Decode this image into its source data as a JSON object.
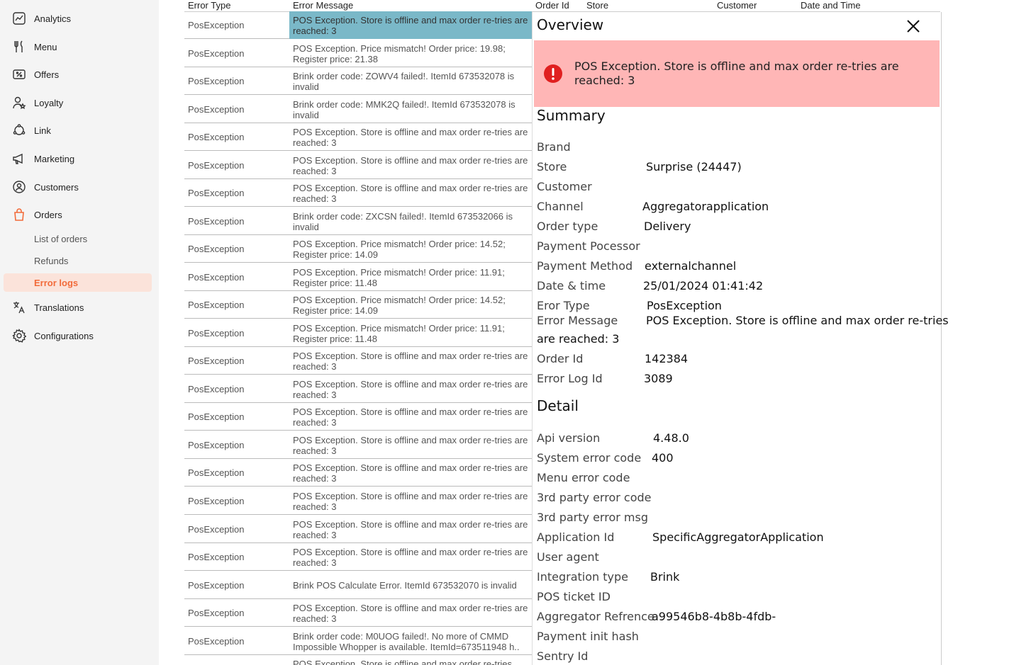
{
  "sidebar": {
    "items": [
      {
        "label": "Analytics",
        "icon": "analytics-icon"
      },
      {
        "label": "Menu",
        "icon": "fork-knife-icon"
      },
      {
        "label": "Offers",
        "icon": "offer-ticket-icon"
      },
      {
        "label": "Loyalty",
        "icon": "user-star-icon"
      },
      {
        "label": "Link",
        "icon": "link-icon"
      },
      {
        "label": "Marketing",
        "icon": "megaphone-icon"
      },
      {
        "label": "Customers",
        "icon": "customers-icon"
      },
      {
        "label": "Orders",
        "icon": "shopping-bag-icon"
      },
      {
        "label": "Translations",
        "icon": "translate-icon"
      },
      {
        "label": "Configurations",
        "icon": "gear-icon"
      }
    ],
    "orders_sub": [
      "List of orders",
      "Refunds",
      "Error logs"
    ],
    "accent": "#f26b3a"
  },
  "table": {
    "headers": {
      "error_type": "Error Type",
      "error_message": "Error Message",
      "order_id": "Order Id",
      "store": "Store",
      "customer": "Customer",
      "date_time": "Date and Time"
    },
    "rows": [
      {
        "type": "PosException",
        "msg": "POS Exception. Store is offline and max order re-tries are reached: 3"
      },
      {
        "type": "PosException",
        "msg": "POS Exception. Price mismatch! Order price: 19.98; Register price: 21.38"
      },
      {
        "type": "PosException",
        "msg": "Brink order code: ZOWV4 failed!. ItemId 673532078 is invalid"
      },
      {
        "type": "PosException",
        "msg": "Brink order code: MMK2Q failed!. ItemId 673532078 is invalid"
      },
      {
        "type": "PosException",
        "msg": "POS Exception. Store is offline and max order re-tries are reached: 3"
      },
      {
        "type": "PosException",
        "msg": "POS Exception. Store is offline and max order re-tries are reached: 3"
      },
      {
        "type": "PosException",
        "msg": "POS Exception. Store is offline and max order re-tries are reached: 3"
      },
      {
        "type": "PosException",
        "msg": "Brink order code: ZXCSN failed!. ItemId 673532066 is invalid"
      },
      {
        "type": "PosException",
        "msg": "POS Exception. Price mismatch! Order price: 14.52; Register price: 14.09"
      },
      {
        "type": "PosException",
        "msg": "POS Exception. Price mismatch! Order price: 11.91; Register price: 11.48"
      },
      {
        "type": "PosException",
        "msg": "POS Exception. Price mismatch! Order price: 14.52; Register price: 14.09"
      },
      {
        "type": "PosException",
        "msg": "POS Exception. Price mismatch! Order price: 11.91; Register price: 11.48"
      },
      {
        "type": "PosException",
        "msg": "POS Exception. Store is offline and max order re-tries are reached: 3"
      },
      {
        "type": "PosException",
        "msg": "POS Exception. Store is offline and max order re-tries are reached: 3"
      },
      {
        "type": "PosException",
        "msg": "POS Exception. Store is offline and max order re-tries are reached: 3"
      },
      {
        "type": "PosException",
        "msg": "POS Exception. Store is offline and max order re-tries are reached: 3"
      },
      {
        "type": "PosException",
        "msg": "POS Exception. Store is offline and max order re-tries are reached: 3"
      },
      {
        "type": "PosException",
        "msg": "POS Exception. Store is offline and max order re-tries are reached: 3"
      },
      {
        "type": "PosException",
        "msg": "POS Exception. Store is offline and max order re-tries are reached: 3"
      },
      {
        "type": "PosException",
        "msg": "POS Exception. Store is offline and max order re-tries are reached: 3"
      },
      {
        "type": "PosException",
        "msg": "Brink POS Calculate Error. ItemId 673532070 is invalid"
      },
      {
        "type": "PosException",
        "msg": "POS Exception. Store is offline and max order re-tries are reached: 3"
      },
      {
        "type": "PosException",
        "msg": "Brink order code: M0UOG failed!. No more of CMMD Impossible Whopper is available. ItemId=673511948 h.."
      },
      {
        "type": "",
        "msg": "POS Exception. Store is offline and max order re-tries"
      }
    ],
    "selected_color": "#7ab8c8"
  },
  "overview": {
    "title": "Overview",
    "alert_text": "POS Exception. Store is offline and max order re-tries are reached: 3",
    "alert_bg": "#ffb6b6",
    "summary_title": "Summary",
    "summary": {
      "brand_label": "Brand",
      "brand_value": "",
      "store_label": "Store",
      "store_value": "Surprise (24447)",
      "customer_label": "Customer",
      "customer_value": "",
      "channel_label": "Channel",
      "channel_value": "Aggregatorapplication",
      "order_type_label": "Order type",
      "order_type_value": "Delivery",
      "payment_processor_label": "Payment Pocessor",
      "payment_processor_value": "",
      "payment_method_label": "Payment Method",
      "payment_method_value": "externalchannel",
      "date_label": "Date & time",
      "date_value": "25/01/2024 01:41:42",
      "error_type_label": "Eror Type",
      "error_type_value": "PosException",
      "error_message_label": "Error Message",
      "error_message_value": "POS Exception. Store is offline and max order re-tries",
      "error_message_cont": "are reached: 3",
      "order_id_label": "Order Id",
      "order_id_value": "142384",
      "error_log_id_label": "Error Log Id",
      "error_log_id_value": "3089"
    },
    "detail_title": "Detail",
    "detail": {
      "api_version_label": "Api version",
      "api_version_value": "4.48.0",
      "system_error_label": "System error code",
      "system_error_value": "400",
      "menu_error_label": "Menu error code",
      "menu_error_value": "",
      "third_party_code_label": "3rd party error code",
      "third_party_code_value": "",
      "third_party_msg_label": "3rd party error msg",
      "third_party_msg_value": "",
      "application_id_label": "Application Id",
      "application_id_value": "SpecificAggregatorApplication",
      "user_agent_label": "User agent",
      "user_agent_value": "",
      "integration_type_label": "Integration type",
      "integration_type_value": "Brink",
      "pos_ticket_label": "POS ticket ID",
      "pos_ticket_value": "",
      "aggregator_ref_label": "Aggregator Refrence",
      "aggregator_ref_value": "a99546b8-4b8b-4fdb-",
      "payment_init_label": "Payment init hash",
      "payment_init_value": "",
      "sentry_label": "Sentry Id",
      "sentry_value": ""
    }
  }
}
